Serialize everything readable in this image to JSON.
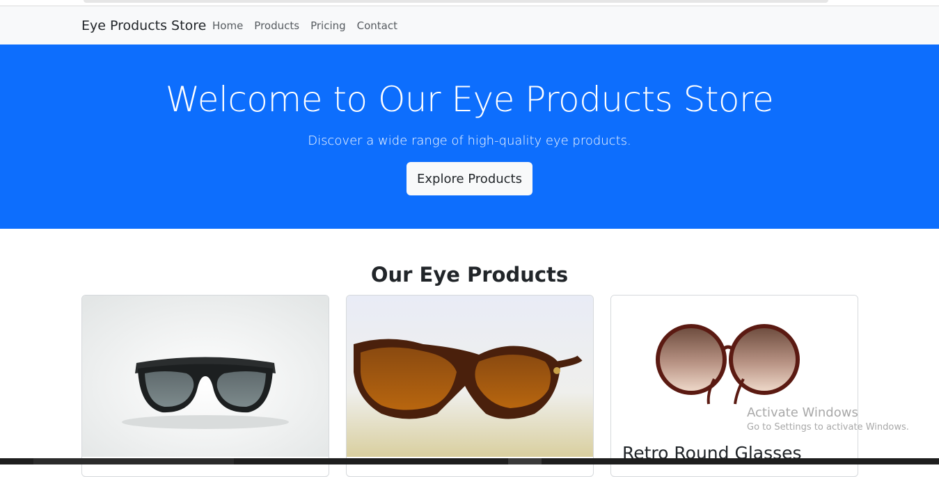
{
  "navbar": {
    "brand": "Eye Products Store",
    "links": [
      "Home",
      "Products",
      "Pricing",
      "Contact"
    ]
  },
  "hero": {
    "title": "Welcome to Our Eye Products Store",
    "subtitle": "Discover a wide range of high-quality eye products.",
    "button_label": "Explore Products"
  },
  "products_section": {
    "title": "Our Eye Products",
    "cards": [
      {
        "image_icon": "wraparound-sunglasses-icon",
        "title": ""
      },
      {
        "image_icon": "brown-sport-sunglasses-icon",
        "title": ""
      },
      {
        "image_icon": "retro-round-glasses-icon",
        "title": "Retro Round Glasses"
      }
    ]
  },
  "os_watermark": {
    "line1": "Activate Windows",
    "line2": "Go to Settings to activate Windows."
  },
  "colors": {
    "hero_bg": "#0d6efd",
    "navbar_bg": "#f8f9fa",
    "text": "#212529"
  }
}
